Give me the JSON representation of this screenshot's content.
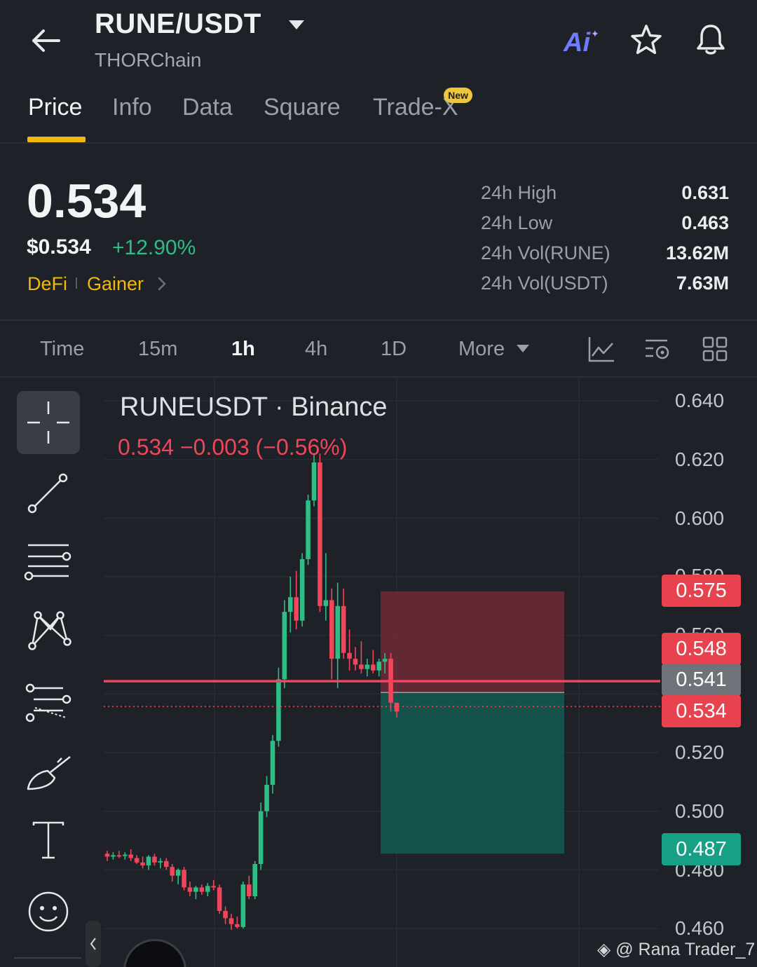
{
  "header": {
    "pair": "RUNE/USDT",
    "chain": "THORChain",
    "ai_label": "Ai"
  },
  "tabs": [
    {
      "label": "Price",
      "active": true
    },
    {
      "label": "Info"
    },
    {
      "label": "Data"
    },
    {
      "label": "Square"
    },
    {
      "label": "Trade-X",
      "badge": "New"
    }
  ],
  "price": {
    "last": "0.534",
    "usd": "$0.534",
    "change": "+12.90%",
    "tags": [
      "DeFi",
      "Gainer"
    ]
  },
  "stats": [
    {
      "label": "24h High",
      "value": "0.631"
    },
    {
      "label": "24h Low",
      "value": "0.463"
    },
    {
      "label": "24h Vol(RUNE)",
      "value": "13.62M"
    },
    {
      "label": "24h Vol(USDT)",
      "value": "7.63M"
    }
  ],
  "timeframes": [
    {
      "label": "Time"
    },
    {
      "label": "15m"
    },
    {
      "label": "1h",
      "active": true
    },
    {
      "label": "4h"
    },
    {
      "label": "1D"
    },
    {
      "label": "More"
    }
  ],
  "chart": {
    "title": "RUNEUSDT · Binance",
    "ohlc": "0.534  −0.003 (−0.56%)",
    "axis": [
      "0.640",
      "0.620",
      "0.600",
      "0.580",
      "0.560",
      "0.520",
      "0.500",
      "0.480",
      "0.460"
    ],
    "tags": {
      "stop": "0.575",
      "entry": "0.548",
      "line": "0.541",
      "last": "0.534",
      "target": "0.487"
    },
    "watermark": "@ Rana Trader_7"
  },
  "colors": {
    "up": "#2ebd85",
    "down": "#f0455a",
    "accent": "#f0b90b"
  },
  "chart_data": {
    "type": "candlestick",
    "title": "RUNEUSDT · Binance",
    "ylim": [
      0.455,
      0.645
    ],
    "candles": [
      {
        "o": 0.4855,
        "h": 0.4865,
        "l": 0.483,
        "c": 0.4845
      },
      {
        "o": 0.4845,
        "h": 0.486,
        "l": 0.4835,
        "c": 0.485
      },
      {
        "o": 0.485,
        "h": 0.4865,
        "l": 0.484,
        "c": 0.4848
      },
      {
        "o": 0.4848,
        "h": 0.486,
        "l": 0.4835,
        "c": 0.4852
      },
      {
        "o": 0.4852,
        "h": 0.487,
        "l": 0.483,
        "c": 0.484
      },
      {
        "o": 0.484,
        "h": 0.485,
        "l": 0.482,
        "c": 0.4825
      },
      {
        "o": 0.4825,
        "h": 0.4845,
        "l": 0.4805,
        "c": 0.4815
      },
      {
        "o": 0.4815,
        "h": 0.485,
        "l": 0.48,
        "c": 0.4845
      },
      {
        "o": 0.4845,
        "h": 0.4855,
        "l": 0.4815,
        "c": 0.4825
      },
      {
        "o": 0.4825,
        "h": 0.484,
        "l": 0.4805,
        "c": 0.483
      },
      {
        "o": 0.483,
        "h": 0.484,
        "l": 0.48,
        "c": 0.481
      },
      {
        "o": 0.481,
        "h": 0.482,
        "l": 0.476,
        "c": 0.478
      },
      {
        "o": 0.478,
        "h": 0.4805,
        "l": 0.475,
        "c": 0.48
      },
      {
        "o": 0.48,
        "h": 0.481,
        "l": 0.473,
        "c": 0.474
      },
      {
        "o": 0.474,
        "h": 0.476,
        "l": 0.471,
        "c": 0.4725
      },
      {
        "o": 0.4725,
        "h": 0.4745,
        "l": 0.47,
        "c": 0.474
      },
      {
        "o": 0.474,
        "h": 0.475,
        "l": 0.4715,
        "c": 0.4725
      },
      {
        "o": 0.4725,
        "h": 0.4755,
        "l": 0.471,
        "c": 0.4745
      },
      {
        "o": 0.4745,
        "h": 0.4765,
        "l": 0.473,
        "c": 0.474
      },
      {
        "o": 0.474,
        "h": 0.475,
        "l": 0.465,
        "c": 0.466
      },
      {
        "o": 0.466,
        "h": 0.4675,
        "l": 0.4615,
        "c": 0.4635
      },
      {
        "o": 0.4635,
        "h": 0.465,
        "l": 0.4595,
        "c": 0.4615
      },
      {
        "o": 0.4615,
        "h": 0.464,
        "l": 0.46,
        "c": 0.4605
      },
      {
        "o": 0.4605,
        "h": 0.476,
        "l": 0.46,
        "c": 0.475
      },
      {
        "o": 0.475,
        "h": 0.478,
        "l": 0.47,
        "c": 0.471
      },
      {
        "o": 0.471,
        "h": 0.483,
        "l": 0.47,
        "c": 0.482
      },
      {
        "o": 0.482,
        "h": 0.503,
        "l": 0.48,
        "c": 0.5
      },
      {
        "o": 0.5,
        "h": 0.512,
        "l": 0.498,
        "c": 0.509
      },
      {
        "o": 0.509,
        "h": 0.526,
        "l": 0.506,
        "c": 0.524
      },
      {
        "o": 0.524,
        "h": 0.549,
        "l": 0.522,
        "c": 0.545
      },
      {
        "o": 0.545,
        "h": 0.572,
        "l": 0.542,
        "c": 0.568
      },
      {
        "o": 0.568,
        "h": 0.58,
        "l": 0.561,
        "c": 0.573
      },
      {
        "o": 0.573,
        "h": 0.582,
        "l": 0.562,
        "c": 0.565
      },
      {
        "o": 0.565,
        "h": 0.588,
        "l": 0.563,
        "c": 0.586
      },
      {
        "o": 0.586,
        "h": 0.608,
        "l": 0.584,
        "c": 0.606
      },
      {
        "o": 0.606,
        "h": 0.622,
        "l": 0.604,
        "c": 0.619
      },
      {
        "o": 0.619,
        "h": 0.622,
        "l": 0.568,
        "c": 0.57
      },
      {
        "o": 0.57,
        "h": 0.588,
        "l": 0.565,
        "c": 0.572
      },
      {
        "o": 0.572,
        "h": 0.576,
        "l": 0.545,
        "c": 0.552
      },
      {
        "o": 0.552,
        "h": 0.578,
        "l": 0.542,
        "c": 0.57
      },
      {
        "o": 0.57,
        "h": 0.576,
        "l": 0.552,
        "c": 0.554
      },
      {
        "o": 0.554,
        "h": 0.562,
        "l": 0.548,
        "c": 0.552
      },
      {
        "o": 0.552,
        "h": 0.556,
        "l": 0.548,
        "c": 0.55
      },
      {
        "o": 0.55,
        "h": 0.558,
        "l": 0.547,
        "c": 0.5485
      },
      {
        "o": 0.5485,
        "h": 0.552,
        "l": 0.546,
        "c": 0.55
      },
      {
        "o": 0.55,
        "h": 0.555,
        "l": 0.547,
        "c": 0.548
      },
      {
        "o": 0.548,
        "h": 0.552,
        "l": 0.546,
        "c": 0.551
      },
      {
        "o": 0.551,
        "h": 0.554,
        "l": 0.547,
        "c": 0.552
      },
      {
        "o": 0.552,
        "h": 0.554,
        "l": 0.534,
        "c": 0.537
      },
      {
        "o": 0.537,
        "h": 0.537,
        "l": 0.532,
        "c": 0.534
      }
    ],
    "position": {
      "stop": 0.575,
      "entry": 0.548,
      "target": 0.487
    },
    "line_price": 0.541,
    "last_price": 0.534
  }
}
